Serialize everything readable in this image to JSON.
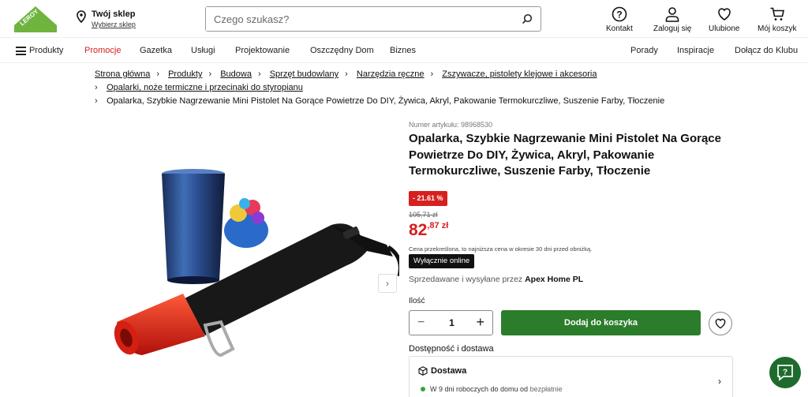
{
  "header": {
    "logo_text": "LEROY MERLIN",
    "store_title": "Twój sklep",
    "store_link": "Wybierz sklep",
    "search_placeholder": "Czego szukasz?",
    "actions": [
      {
        "label": "Kontakt",
        "icon": "question-icon"
      },
      {
        "label": "Zaloguj się",
        "icon": "user-icon"
      },
      {
        "label": "Ulubione",
        "icon": "heart-icon"
      },
      {
        "label": "Mój koszyk",
        "icon": "cart-icon"
      }
    ]
  },
  "nav": {
    "left": [
      "Produkty",
      "Promocje",
      "Gazetka",
      "Usługi",
      "Projektowanie",
      "Oszczędny Dom",
      "Biznes"
    ],
    "right": [
      "Porady",
      "Inspiracje",
      "Dołącz do Klubu"
    ]
  },
  "breadcrumb": {
    "row1": [
      "Strona główna",
      "Produkty",
      "Budowa",
      "Sprzęt budowlany",
      "Narzędzia ręczne",
      "Zszywacze, pistolety klejowe i akcesoria"
    ],
    "row2": "Opalarki, noże termiczne i przecinaki do styropianu",
    "row3": "Opalarka, Szybkie Nagrzewanie Mini Pistolet Na Gorące Powietrze Do DIY, Żywica, Akryl, Pakowanie Termokurczliwe, Suszenie Farby, Tłoczenie"
  },
  "product": {
    "sku": "Numer artykułu: 98968530",
    "title": "Opalarka, Szybkie Nagrzewanie Mini Pistolet Na Gorące Powietrze Do DIY, Żywica, Akryl, Pakowanie Termokurczliwe, Suszenie Farby, Tłoczenie",
    "discount": "- 21.61 %",
    "old_price": "105,71 zł",
    "price_main": "82",
    "price_fraction": ",87 zł",
    "lowest_note": "Cena przekreślona, to najniższa cena w okresie 30 dni przed obniżką.",
    "online_badge": "Wyłącznie online",
    "seller_prefix": "Sprzedawane i wysyłane przez",
    "seller_name": "Apex Home PL",
    "qty_label": "Ilość",
    "qty_value": "1",
    "add_to_cart": "Dodaj do koszyka",
    "availability": "Dostępność i dostawa",
    "delivery_title": "Dostawa",
    "delivery_line": "W 9 dni roboczych do domu od",
    "delivery_free": "bezpłatnie"
  },
  "colors": {
    "brand_green": "#2b7d2b",
    "promo_red": "#d6201f",
    "help_green": "#1e6b2e"
  }
}
